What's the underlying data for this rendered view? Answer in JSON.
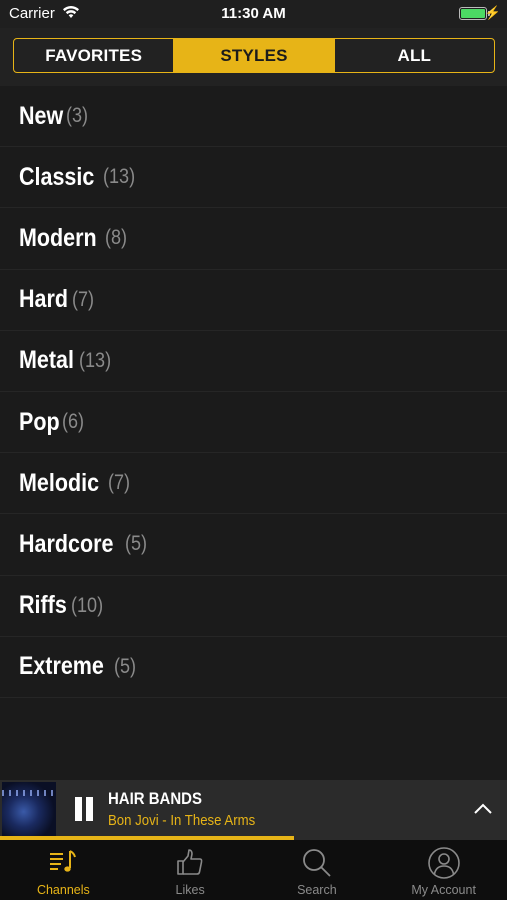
{
  "status_bar": {
    "carrier": "Carrier",
    "time": "11:30 AM",
    "battery_color": "#4cd964"
  },
  "segments": [
    {
      "label": "FAVORITES",
      "active": false
    },
    {
      "label": "STYLES",
      "active": true
    },
    {
      "label": "ALL",
      "active": false
    }
  ],
  "styles": [
    {
      "name": "New",
      "count": "(3)"
    },
    {
      "name": "Classic",
      "count": "(13)"
    },
    {
      "name": "Modern",
      "count": "(8)"
    },
    {
      "name": "Hard",
      "count": "(7)"
    },
    {
      "name": "Metal",
      "count": "(13)"
    },
    {
      "name": "Pop",
      "count": "(6)"
    },
    {
      "name": "Melodic",
      "count": "(7)"
    },
    {
      "name": "Hardcore",
      "count": "(5)"
    },
    {
      "name": "Riffs",
      "count": "(10)"
    },
    {
      "name": "Extreme",
      "count": "(5)"
    }
  ],
  "player": {
    "channel": "HAIR BANDS",
    "track": "Bon Jovi - In These Arms",
    "progress_fraction": 0.58,
    "state_icon": "pause-icon"
  },
  "tabs": [
    {
      "label": "Channels",
      "icon": "channels-icon",
      "active": true
    },
    {
      "label": "Likes",
      "icon": "thumbs-up-icon",
      "active": false
    },
    {
      "label": "Search",
      "icon": "search-icon",
      "active": false
    },
    {
      "label": "My Account",
      "icon": "account-icon",
      "active": false
    }
  ],
  "colors": {
    "accent": "#e7b417",
    "background": "#1b1b1b",
    "muted": "#8a8a8a"
  }
}
